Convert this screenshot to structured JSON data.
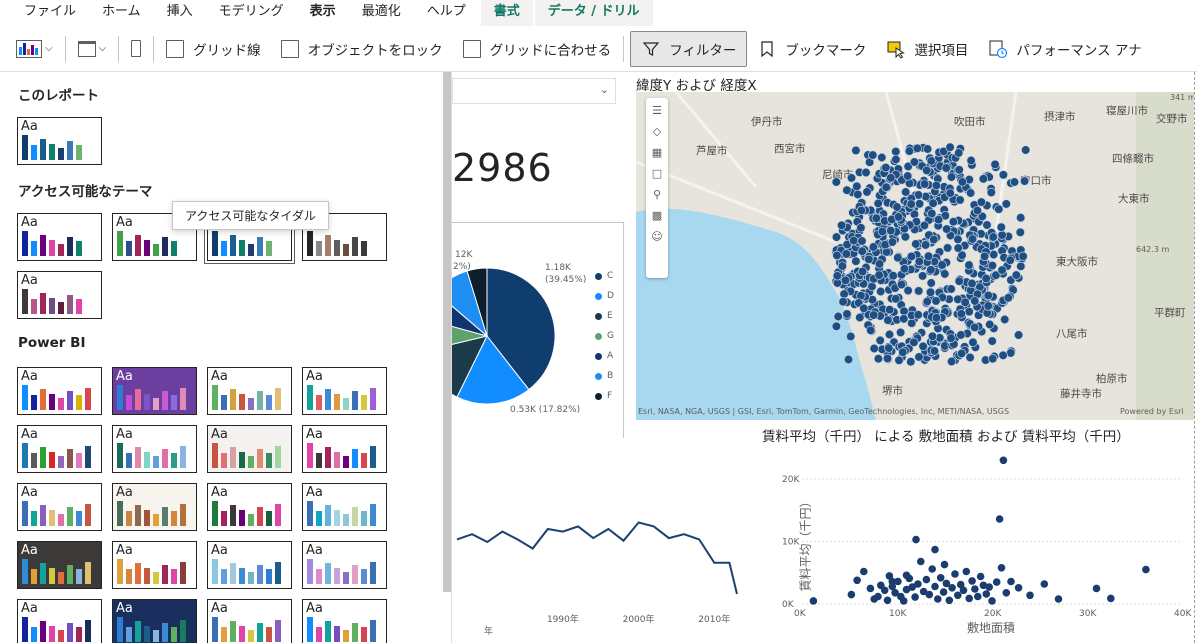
{
  "ribbon": {
    "tabs": [
      {
        "label": "ファイル",
        "active": false,
        "context": false
      },
      {
        "label": "ホーム",
        "active": false,
        "context": false
      },
      {
        "label": "挿入",
        "active": false,
        "context": false
      },
      {
        "label": "モデリング",
        "active": false,
        "context": false
      },
      {
        "label": "表示",
        "active": true,
        "context": false
      },
      {
        "label": "最適化",
        "active": false,
        "context": false
      },
      {
        "label": "ヘルプ",
        "active": false,
        "context": false
      },
      {
        "label": "書式",
        "active": false,
        "context": true
      },
      {
        "label": "データ / ドリル",
        "active": false,
        "context": true
      }
    ]
  },
  "toolbar": {
    "gridlines": "グリッド線",
    "lock_objects": "オブジェクトをロック",
    "snap_to_grid": "グリッドに合わせる",
    "filter": "フィルター",
    "bookmark": "ブックマーク",
    "selection": "選択項目",
    "performance": "パフォーマンス アナ"
  },
  "theme_pane": {
    "sections": {
      "this_report": "このレポート",
      "accessible": "アクセス可能なテーマ",
      "powerbi": "Power BI"
    },
    "tooltip": "アクセス可能なタイダル",
    "swatch_text": "Aa",
    "this_report_themes": [
      {
        "bg": "#ffffff",
        "dark": false,
        "colors": [
          "#118dff",
          "#12239e",
          "#e66c37",
          "#6b007b",
          "#e044a7",
          "#744ec2",
          "#d9b300",
          "#d64550"
        ],
        "override": [
          "#0f3e6e",
          "#118dff",
          "#1a5e8e",
          "#11806a",
          "#1f3b70",
          "#3a7ab5",
          "#6db36f"
        ]
      }
    ],
    "accessible_themes": [
      {
        "bg": "#ffffff",
        "dark": false,
        "colors": [
          "#12239e",
          "#118dff",
          "#6b007b",
          "#e044a7",
          "#a3245b",
          "#1b2d5c",
          "#11806a"
        ]
      },
      {
        "bg": "#ffffff",
        "dark": false,
        "colors": [
          "#41a146",
          "#2d4d8b",
          "#a3245b",
          "#6b007b",
          "#41a146",
          "#1b2d5c",
          "#11806a"
        ]
      },
      {
        "bg": "#ffffff",
        "dark": false,
        "colors": [
          "#0f3e6e",
          "#118dff",
          "#1a5e8e",
          "#11806a",
          "#1f3b70",
          "#3a7ab5",
          "#6db36f"
        ]
      },
      {
        "bg": "#ffffff",
        "dark": false,
        "colors": [
          "#252423",
          "#8a8886",
          "#a57d6a",
          "#605e5c",
          "#6a4d3f",
          "#484644",
          "#3b3a39"
        ]
      },
      {
        "bg": "#ffffff",
        "dark": false,
        "colors": [
          "#3b3a39",
          "#b2588f",
          "#a3245b",
          "#6b4d8a",
          "#5e1f3c",
          "#8a5d84",
          "#e044a7"
        ]
      }
    ],
    "powerbi_themes": [
      {
        "bg": "#ffffff",
        "dark": false,
        "colors": [
          "#118dff",
          "#12239e",
          "#e66c37",
          "#6b007b",
          "#e044a7",
          "#744ec2",
          "#d9b300",
          "#d64550"
        ]
      },
      {
        "bg": "#6b3fa0",
        "dark": true,
        "colors": [
          "#2f7cd6",
          "#c44bd6",
          "#e66c9b",
          "#7a56c8",
          "#e6a0c8",
          "#c85ad6",
          "#8c6be0",
          "#e08ab8"
        ]
      },
      {
        "bg": "#ffffff",
        "dark": false,
        "colors": [
          "#5fb05f",
          "#3b6fb5",
          "#d6a13b",
          "#c8553d",
          "#8a6fbf",
          "#6fb5a1",
          "#5b8bd6",
          "#e0c06f"
        ]
      },
      {
        "bg": "#ffffff",
        "dark": false,
        "colors": [
          "#12a39b",
          "#e45b5b",
          "#3b8bd6",
          "#e09a3b",
          "#8ad6c8",
          "#3b6fb5",
          "#d6c83b",
          "#a15fd6"
        ]
      },
      {
        "bg": "#ffffff",
        "dark": false,
        "colors": [
          "#1f77b4",
          "#5b5b5b",
          "#2ca02c",
          "#d62728",
          "#9467bd",
          "#8c564b",
          "#e377c2",
          "#1f4a6e"
        ]
      },
      {
        "bg": "#ffffff",
        "dark": false,
        "colors": [
          "#1a6b5e",
          "#3b6fb5",
          "#e08aa8",
          "#7fd6c8",
          "#5fa0e0",
          "#e06fa8",
          "#2f9a8a",
          "#8ab5e0"
        ]
      },
      {
        "bg": "#f3f2f1",
        "dark": false,
        "colors": [
          "#c8553d",
          "#e06f6f",
          "#d6a1a1",
          "#1a6b4a",
          "#5fb05f",
          "#e08a6f",
          "#3b8a5f",
          "#a1d6a1"
        ]
      },
      {
        "bg": "#ffffff",
        "dark": false,
        "colors": [
          "#e044a7",
          "#3b3a39",
          "#a3245b",
          "#e06fa8",
          "#6b007b",
          "#118dff",
          "#d64550",
          "#1a5e8e"
        ]
      },
      {
        "bg": "#ffffff",
        "dark": false,
        "colors": [
          "#3b6fb5",
          "#12a39b",
          "#8a5fbf",
          "#e0c06f",
          "#e06fa8",
          "#5fb05f",
          "#3b8bd6",
          "#c8553d"
        ]
      },
      {
        "bg": "#f7f5ee",
        "dark": false,
        "colors": [
          "#4a6b5e",
          "#c8853d",
          "#8a6a4a",
          "#a1553d",
          "#e0a13b",
          "#5b7b6b",
          "#d6853d",
          "#b56f3b"
        ]
      },
      {
        "bg": "#ffffff",
        "dark": false,
        "colors": [
          "#1a7b3b",
          "#a3245b",
          "#3b3a39",
          "#6b007b",
          "#5fb05f",
          "#d64550",
          "#1a5e3b",
          "#e044a7"
        ]
      },
      {
        "bg": "#ffffff",
        "dark": false,
        "colors": [
          "#3b6fb5",
          "#12a3c8",
          "#5fb5e0",
          "#a1d6e0",
          "#8ac8d6",
          "#c8d6a1",
          "#6fb5c8",
          "#3b8bd6"
        ]
      },
      {
        "bg": "#3b3a39",
        "dark": true,
        "colors": [
          "#2f8bd6",
          "#e0a13b",
          "#12a39b",
          "#d6c83b",
          "#e06f3b",
          "#5fb05f",
          "#8ab5e0",
          "#e0c06f"
        ]
      },
      {
        "bg": "#ffffff",
        "dark": false,
        "colors": [
          "#e0a13b",
          "#d6853d",
          "#e06f3b",
          "#c8553d",
          "#d6c83b",
          "#a3245b",
          "#e044a7",
          "#8a3b3b"
        ]
      },
      {
        "bg": "#ffffff",
        "dark": false,
        "colors": [
          "#8ac8e0",
          "#5fa0e0",
          "#a1c8e0",
          "#3b8bd6",
          "#6fb5c8",
          "#5b8bd6",
          "#2f7cd6",
          "#1a5e8e"
        ]
      },
      {
        "bg": "#ffffff",
        "dark": false,
        "colors": [
          "#a18ae0",
          "#e08ac8",
          "#6fb5e0",
          "#c8a1e0",
          "#8a6fbf",
          "#e0a1c8",
          "#5b8bd6",
          "#3b6fb5"
        ]
      },
      {
        "bg": "#ffffff",
        "dark": false,
        "colors": [
          "#12239e",
          "#118dff",
          "#6b007b",
          "#e044a7",
          "#d64550",
          "#744ec2",
          "#a3245b",
          "#1b2d5c"
        ]
      },
      {
        "bg": "#1a2f5e",
        "dark": true,
        "colors": [
          "#2f7cd6",
          "#5fa0e0",
          "#12a39b",
          "#1a5e8e",
          "#8ab5e0",
          "#3b8bd6",
          "#5fb05f",
          "#1a7b5e"
        ]
      },
      {
        "bg": "#ffffff",
        "dark": false,
        "colors": [
          "#3b6fb5",
          "#e0a13b",
          "#5fb05f",
          "#e044a7",
          "#d6c83b",
          "#12a39b",
          "#c8553d",
          "#8a5fbf"
        ]
      },
      {
        "bg": "#ffffff",
        "dark": false,
        "colors": [
          "#118dff",
          "#e044a7",
          "#12a39b",
          "#744ec2",
          "#e0a13b",
          "#5fb05f",
          "#d64550",
          "#3b6fb5"
        ]
      }
    ]
  },
  "visuals": {
    "card_value": "2986",
    "pie": {
      "labels": [
        {
          "text": "1.18K",
          "sub": "(39.45%)"
        },
        {
          "text": "0.53K (17.82%)",
          "sub": ""
        },
        {
          "text": "12K",
          "sub": "2%)"
        }
      ],
      "legend": [
        "C",
        "D",
        "E",
        "G",
        "A",
        "B",
        "F"
      ],
      "legend_colors": [
        "#0f3e6e",
        "#118dff",
        "#1b3b4a",
        "#5fa06f",
        "#12346e",
        "#1f8ef2",
        "#0d1f2d"
      ]
    },
    "map": {
      "title": "緯度Y および 経度X",
      "attribution": "Esri, NASA, NGA, USGS | GSI, Esri, TomTom, Garmin, GeoTechnologies, Inc, METI/NASA, USGS",
      "powered": "Powered by Esri",
      "cities": [
        "伊丹市",
        "吹田市",
        "摂津市",
        "寝屋川市",
        "交野市",
        "芦屋市",
        "西宮市",
        "守口市",
        "四條畷市",
        "尼崎市",
        "大東市",
        "東大阪市",
        "八尾市",
        "堺市",
        "柏原市",
        "藤井寺市",
        "平群町"
      ],
      "scale_label": "341 m",
      "mt_label": "642.3 m"
    },
    "scatter": {
      "title": "賃料平均（千円） による 敷地面積 および 賃料平均（千円）",
      "xlabel": "敷地面積",
      "ylabel": "賃料平均（千円）"
    },
    "line": {
      "xlabel": "年"
    }
  },
  "chart_data": [
    {
      "type": "pie",
      "categories": [
        "C",
        "D",
        "E",
        "G",
        "A",
        "B",
        "F"
      ],
      "values": [
        39.45,
        17.82,
        14,
        8,
        7,
        9,
        4.73
      ],
      "title": "",
      "labels": [
        "1.18K (39.45%)",
        "0.53K (17.82%)"
      ]
    },
    {
      "type": "line",
      "x": [
        1976,
        1978,
        1980,
        1982,
        1984,
        1986,
        1988,
        1990,
        1992,
        1994,
        1996,
        1998,
        2000,
        2002,
        2004,
        2006,
        2008,
        2010,
        2012,
        2013
      ],
      "y": [
        0.62,
        0.66,
        0.6,
        0.68,
        0.62,
        0.55,
        0.7,
        0.68,
        0.72,
        0.63,
        0.7,
        0.61,
        0.75,
        0.72,
        0.63,
        0.66,
        0.62,
        0.44,
        0.44,
        0.2
      ],
      "xticks": [
        "1990年",
        "2000年",
        "2010年"
      ],
      "xlabel": "年",
      "ylabel": ""
    },
    {
      "type": "scatter",
      "title": "賃料平均（千円） による 敷地面積 および 賃料平均（千円）",
      "xlabel": "敷地面積",
      "ylabel": "賃料平均（千円）",
      "xticks": [
        "0K",
        "10K",
        "20K",
        "30K",
        "40K"
      ],
      "yticks": [
        "0K",
        "10K",
        "20K"
      ],
      "xlim": [
        0,
        40000
      ],
      "ylim": [
        0,
        24000
      ],
      "x": [
        1200,
        5200,
        5800,
        6500,
        7200,
        7600,
        8000,
        8300,
        8700,
        9000,
        9200,
        9500,
        9800,
        10100,
        10400,
        10700,
        11000,
        11300,
        11600,
        11900,
        12200,
        12500,
        12800,
        13100,
        13400,
        13700,
        14000,
        14300,
        14600,
        14900,
        15200,
        15500,
        15800,
        16100,
        16400,
        16700,
        17000,
        17300,
        17600,
        17900,
        18200,
        18500,
        18800,
        19100,
        19400,
        19700,
        20000,
        20500,
        21000,
        21500,
        22000,
        22800,
        24000,
        25500,
        27000,
        31000,
        32500,
        36200,
        20800,
        21200,
        12000,
        14000,
        15000,
        9500,
        11000
      ],
      "y": [
        500,
        1500,
        3800,
        5200,
        2500,
        800,
        1200,
        3000,
        2200,
        600,
        4500,
        2800,
        1800,
        3600,
        1200,
        500,
        2300,
        4100,
        2700,
        1100,
        3200,
        6800,
        2000,
        3900,
        1500,
        5600,
        2800,
        800,
        4200,
        1900,
        3300,
        600,
        2600,
        4800,
        1400,
        3100,
        2200,
        5200,
        900,
        3700,
        2400,
        1200,
        4400,
        3000,
        1600,
        2700,
        500,
        3500,
        5800,
        1800,
        3600,
        2600,
        1400,
        3200,
        800,
        2500,
        900,
        5500,
        13600,
        23000,
        10300,
        8700,
        6300,
        3600,
        4600
      ]
    }
  ]
}
